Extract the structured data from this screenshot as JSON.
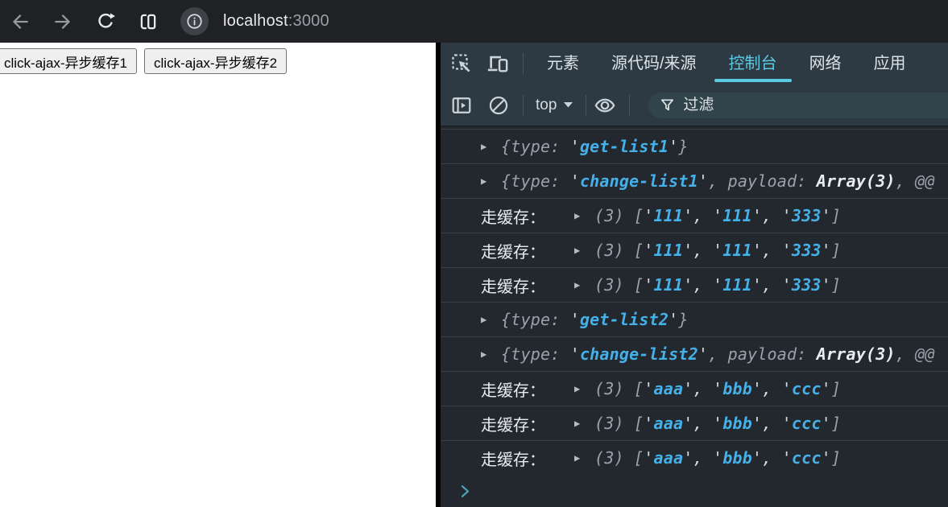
{
  "browser": {
    "url_host": "localhost",
    "url_port": ":3000"
  },
  "page": {
    "buttons": [
      {
        "label": "click-ajax-异步缓存1"
      },
      {
        "label": "click-ajax-异步缓存2"
      }
    ]
  },
  "devtools": {
    "tabs": [
      {
        "id": "elements",
        "label": "元素",
        "selected": false
      },
      {
        "id": "sources",
        "label": "源代码/来源",
        "selected": false
      },
      {
        "id": "console",
        "label": "控制台",
        "selected": true
      },
      {
        "id": "network",
        "label": "网络",
        "selected": false
      },
      {
        "id": "application",
        "label": "应用",
        "selected": false
      }
    ],
    "context_selector": "top",
    "filter_placeholder": "过滤",
    "console": {
      "glyphs": {
        "expand_triangle": "▶",
        "dropdown_arrow": "▼"
      },
      "rows": [
        {
          "segments": [
            [
              "g",
              "{type: "
            ],
            [
              "q",
              "'"
            ],
            [
              "s",
              "get-list1"
            ],
            [
              "q",
              "'"
            ],
            [
              "g",
              "}"
            ]
          ]
        },
        {
          "segments": [
            [
              "g",
              "{type: "
            ],
            [
              "q",
              "'"
            ],
            [
              "s",
              "change-list1"
            ],
            [
              "q",
              "'"
            ],
            [
              "g",
              ", payload: "
            ],
            [
              "w",
              "Array(3)"
            ],
            [
              "g",
              ", @@"
            ]
          ]
        },
        {
          "label": "走缓存：",
          "segments": [
            [
              "g",
              "(3) ["
            ],
            [
              "q",
              "'"
            ],
            [
              "s",
              "111"
            ],
            [
              "q",
              "'"
            ],
            [
              "q",
              ", "
            ],
            [
              "q",
              "'"
            ],
            [
              "s",
              "111"
            ],
            [
              "q",
              "'"
            ],
            [
              "q",
              ", "
            ],
            [
              "q",
              "'"
            ],
            [
              "s",
              "333"
            ],
            [
              "q",
              "'"
            ],
            [
              "g",
              "]"
            ]
          ]
        },
        {
          "label": "走缓存：",
          "segments": [
            [
              "g",
              "(3) ["
            ],
            [
              "q",
              "'"
            ],
            [
              "s",
              "111"
            ],
            [
              "q",
              "'"
            ],
            [
              "q",
              ", "
            ],
            [
              "q",
              "'"
            ],
            [
              "s",
              "111"
            ],
            [
              "q",
              "'"
            ],
            [
              "q",
              ", "
            ],
            [
              "q",
              "'"
            ],
            [
              "s",
              "333"
            ],
            [
              "q",
              "'"
            ],
            [
              "g",
              "]"
            ]
          ]
        },
        {
          "label": "走缓存：",
          "segments": [
            [
              "g",
              "(3) ["
            ],
            [
              "q",
              "'"
            ],
            [
              "s",
              "111"
            ],
            [
              "q",
              "'"
            ],
            [
              "q",
              ", "
            ],
            [
              "q",
              "'"
            ],
            [
              "s",
              "111"
            ],
            [
              "q",
              "'"
            ],
            [
              "q",
              ", "
            ],
            [
              "q",
              "'"
            ],
            [
              "s",
              "333"
            ],
            [
              "q",
              "'"
            ],
            [
              "g",
              "]"
            ]
          ]
        },
        {
          "segments": [
            [
              "g",
              "{type: "
            ],
            [
              "q",
              "'"
            ],
            [
              "s",
              "get-list2"
            ],
            [
              "q",
              "'"
            ],
            [
              "g",
              "}"
            ]
          ]
        },
        {
          "segments": [
            [
              "g",
              "{type: "
            ],
            [
              "q",
              "'"
            ],
            [
              "s",
              "change-list2"
            ],
            [
              "q",
              "'"
            ],
            [
              "g",
              ", payload: "
            ],
            [
              "w",
              "Array(3)"
            ],
            [
              "g",
              ", @@"
            ]
          ]
        },
        {
          "label": "走缓存：",
          "segments": [
            [
              "g",
              "(3) ["
            ],
            [
              "q",
              "'"
            ],
            [
              "s",
              "aaa"
            ],
            [
              "q",
              "'"
            ],
            [
              "q",
              ", "
            ],
            [
              "q",
              "'"
            ],
            [
              "s",
              "bbb"
            ],
            [
              "q",
              "'"
            ],
            [
              "q",
              ", "
            ],
            [
              "q",
              "'"
            ],
            [
              "s",
              "ccc"
            ],
            [
              "q",
              "'"
            ],
            [
              "g",
              "]"
            ]
          ]
        },
        {
          "label": "走缓存：",
          "segments": [
            [
              "g",
              "(3) ["
            ],
            [
              "q",
              "'"
            ],
            [
              "s",
              "aaa"
            ],
            [
              "q",
              "'"
            ],
            [
              "q",
              ", "
            ],
            [
              "q",
              "'"
            ],
            [
              "s",
              "bbb"
            ],
            [
              "q",
              "'"
            ],
            [
              "q",
              ", "
            ],
            [
              "q",
              "'"
            ],
            [
              "s",
              "ccc"
            ],
            [
              "q",
              "'"
            ],
            [
              "g",
              "]"
            ]
          ]
        },
        {
          "label": "走缓存：",
          "segments": [
            [
              "g",
              "(3) ["
            ],
            [
              "q",
              "'"
            ],
            [
              "s",
              "aaa"
            ],
            [
              "q",
              "'"
            ],
            [
              "q",
              ", "
            ],
            [
              "q",
              "'"
            ],
            [
              "s",
              "bbb"
            ],
            [
              "q",
              "'"
            ],
            [
              "q",
              ", "
            ],
            [
              "q",
              "'"
            ],
            [
              "s",
              "ccc"
            ],
            [
              "q",
              "'"
            ],
            [
              "g",
              "]"
            ]
          ]
        }
      ]
    }
  },
  "colors": {
    "accent_cyan": "#5bcbe2",
    "string_blue": "#45b1e8",
    "muted_gray": "#9aa3ab",
    "toolbar_bg": "#2d3a43",
    "console_bg": "#22282e",
    "chrome_bg": "#202124"
  }
}
